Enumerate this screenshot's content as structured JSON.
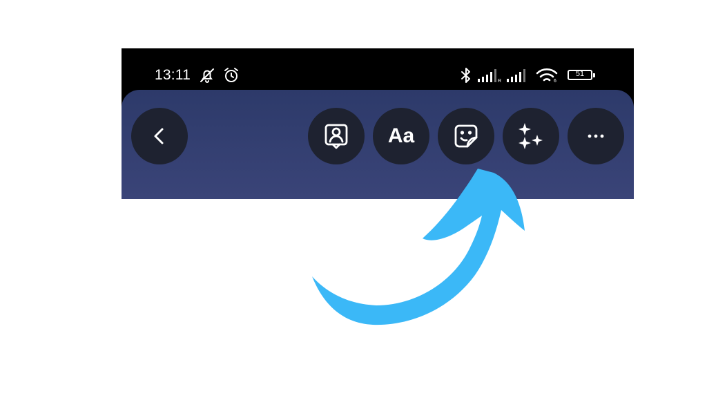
{
  "status_bar": {
    "time": "13:11",
    "battery_text": "51",
    "battery_level": 0.51,
    "icons": [
      "bell-off-icon",
      "alarm-icon",
      "bluetooth-icon",
      "signal-icon",
      "signal-icon",
      "wifi-icon",
      "battery-icon"
    ]
  },
  "toolbar": {
    "back_icon": "chevron-left-icon",
    "text_label": "Aa",
    "buttons": [
      "back-button",
      "profile-button",
      "text-button",
      "sticker-button",
      "effects-button",
      "more-button"
    ]
  },
  "colors": {
    "toolbar_top": "#2d3a6a",
    "toolbar_bottom": "#3a4478",
    "button_bg": "#1e2230",
    "arrow": "#3bb8f7"
  },
  "annotation": {
    "icon": "curved-arrow-icon"
  }
}
